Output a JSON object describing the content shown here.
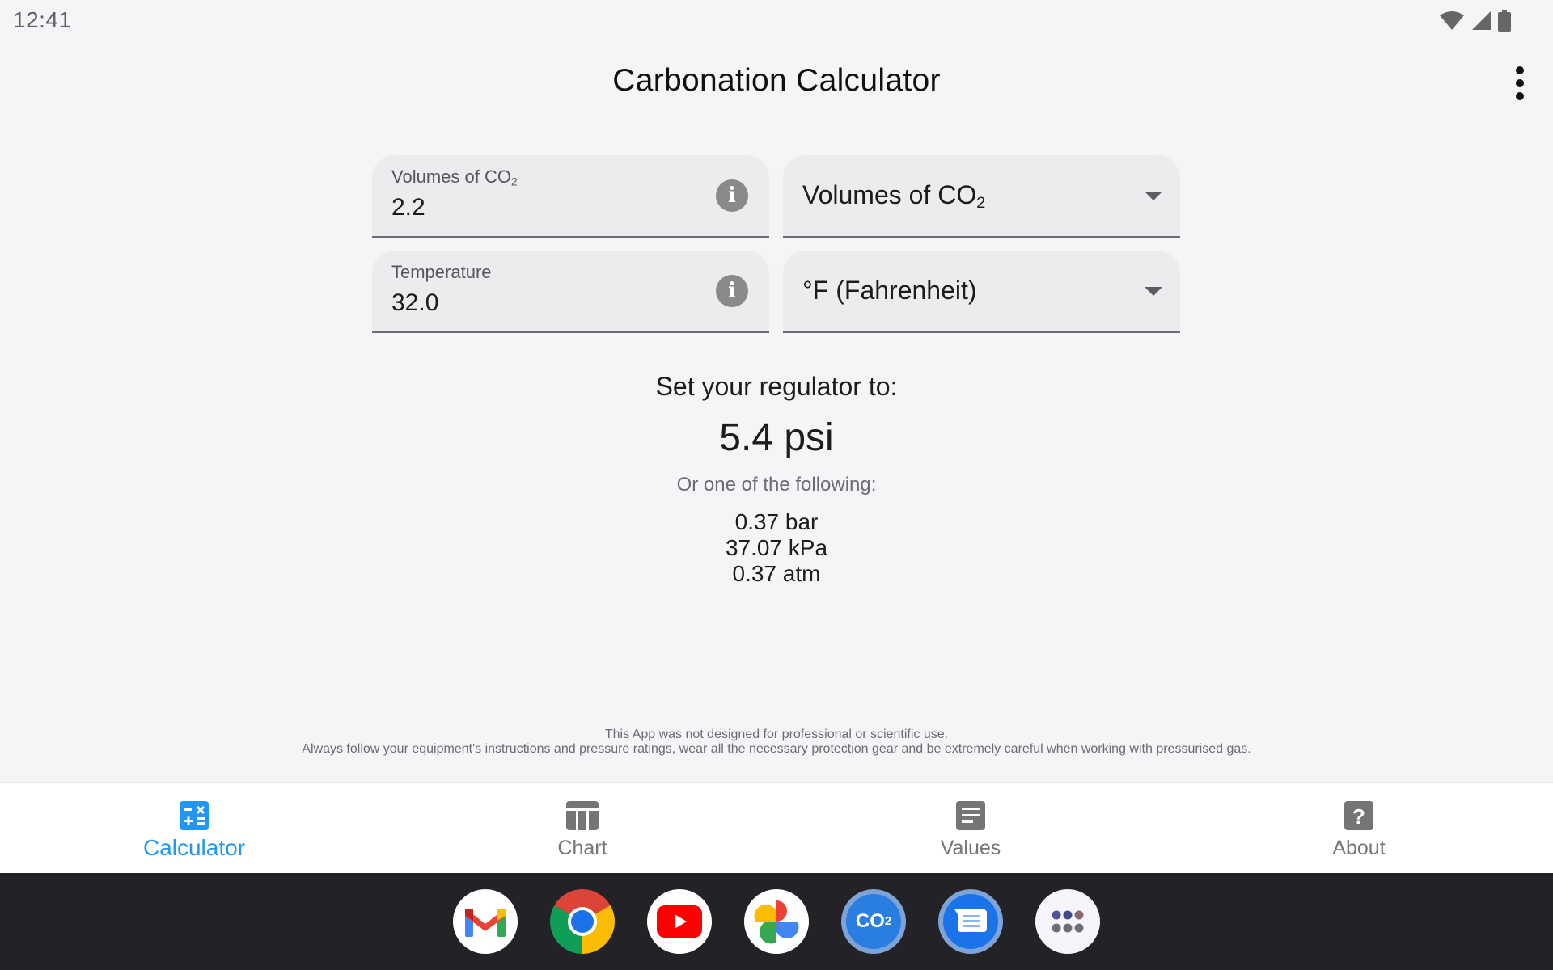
{
  "status_bar": {
    "time": "12:41",
    "icons": [
      "wifi-icon",
      "cellular-signal-icon",
      "battery-icon"
    ]
  },
  "app_bar": {
    "title": "Carbonation Calculator",
    "overflow_icon": "more-vert-icon"
  },
  "form": {
    "co2_input": {
      "label": "Volumes of CO",
      "label_sub": "2",
      "value": "2.2",
      "info_icon": "info-icon"
    },
    "temperature_input": {
      "label": "Temperature",
      "value": "32.0",
      "info_icon": "info-icon"
    },
    "co2_unit_select": {
      "selected": "Volumes of CO",
      "selected_sub": "2",
      "icon": "dropdown-arrow-icon"
    },
    "temperature_unit_select": {
      "selected": "°F (Fahrenheit)",
      "icon": "dropdown-arrow-icon"
    }
  },
  "result": {
    "heading": "Set your regulator to:",
    "primary": "5.4 psi",
    "alternatives_heading": "Or one of the following:",
    "alternatives": [
      "0.37 bar",
      "37.07 kPa",
      "0.37 atm"
    ]
  },
  "disclaimer": {
    "line1": "This App was not designed for professional or scientific use.",
    "line2": "Always follow your equipment's instructions and pressure ratings, wear all the necessary protection gear and be extremely careful when working with pressurised gas."
  },
  "bottom_nav": {
    "active": "Calculator",
    "active_color": "#2196f3",
    "items": [
      {
        "label": "Calculator",
        "icon": "calculator-icon"
      },
      {
        "label": "Chart",
        "icon": "chart-table-icon"
      },
      {
        "label": "Values",
        "icon": "values-list-icon"
      },
      {
        "label": "About",
        "icon": "help-icon"
      }
    ]
  },
  "dock": {
    "apps": [
      {
        "name": "Gmail",
        "icon": "gmail-icon"
      },
      {
        "name": "Chrome",
        "icon": "chrome-icon"
      },
      {
        "name": "YouTube",
        "icon": "youtube-icon"
      },
      {
        "name": "Photos",
        "icon": "photos-icon"
      },
      {
        "name": "Carbonation Calculator",
        "icon": "co2-app-icon",
        "glyph": "CO",
        "glyph_sub": "2"
      },
      {
        "name": "Messages",
        "icon": "messages-icon"
      },
      {
        "name": "App drawer",
        "icon": "app-drawer-icon"
      }
    ]
  }
}
